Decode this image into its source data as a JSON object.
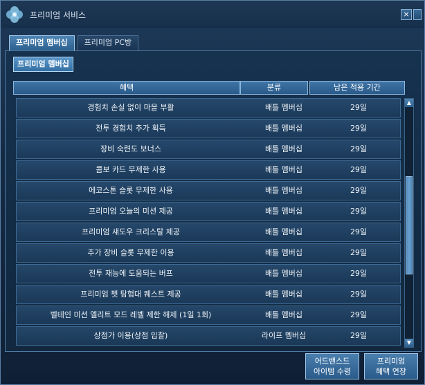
{
  "window": {
    "title": "프리미엄 서비스",
    "close_glyph": "×"
  },
  "tabs": [
    {
      "label": "프리미엄 멤버십",
      "active": true
    },
    {
      "label": "프리미엄 PC방",
      "active": false
    }
  ],
  "subtab": {
    "label": "프리미엄 멤버십"
  },
  "table": {
    "headers": [
      "혜택",
      "분류",
      "남은 적용 기간"
    ],
    "rows": [
      {
        "benefit": "경험치 손실 없이 마을 부활",
        "category": "배틀 멤버십",
        "remaining": "29일"
      },
      {
        "benefit": "전투 경험치 추가 획득",
        "category": "배틀 멤버십",
        "remaining": "29일"
      },
      {
        "benefit": "장비 숙련도 보너스",
        "category": "배틀 멤버십",
        "remaining": "29일"
      },
      {
        "benefit": "콤보 카드 무제한 사용",
        "category": "배틀 멤버십",
        "remaining": "29일"
      },
      {
        "benefit": "에코스톤 슬롯 무제한 사용",
        "category": "배틀 멤버십",
        "remaining": "29일"
      },
      {
        "benefit": "프리미엄 오늘의 미션 제공",
        "category": "배틀 멤버십",
        "remaining": "29일"
      },
      {
        "benefit": "프리미엄 섀도우 크리스탈 제공",
        "category": "배틀 멤버십",
        "remaining": "29일"
      },
      {
        "benefit": "추가 장비 슬롯 무제한 이용",
        "category": "배틀 멤버십",
        "remaining": "29일"
      },
      {
        "benefit": "전투 재능에 도움되는 버프",
        "category": "배틀 멤버십",
        "remaining": "29일"
      },
      {
        "benefit": "프리미엄 펫 탐험대 퀘스트 제공",
        "category": "배틀 멤버십",
        "remaining": "29일"
      },
      {
        "benefit": "벨테인 미션 엘리트 모드 레벨 제한 해제 (1일 1회)",
        "category": "배틀 멤버십",
        "remaining": "29일"
      },
      {
        "benefit": "상점가 이용(상점 입찰)",
        "category": "라이프 멤버십",
        "remaining": "29일"
      }
    ]
  },
  "scroll": {
    "up_glyph": "▲",
    "down_glyph": "▼"
  },
  "buttons": {
    "advanced": {
      "line1": "어드밴스드",
      "line2": "아이템 수령"
    },
    "extend": {
      "line1": "프리미엄",
      "line2": "혜택 연장"
    }
  },
  "colors": {
    "accent": "#4f86b6",
    "panel": "#16324f",
    "border": "#8ab6dc"
  }
}
